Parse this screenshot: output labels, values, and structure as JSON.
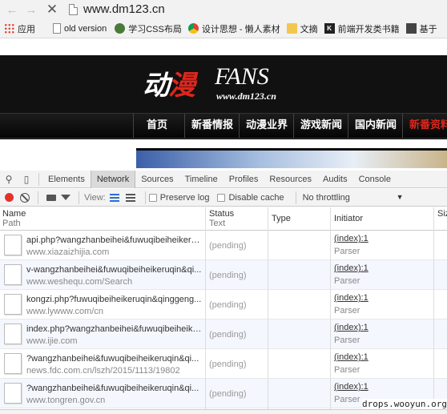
{
  "browser": {
    "url": "www.dm123.cn",
    "bookmarks": [
      {
        "label": "应用",
        "icon": "apps-grid-icon"
      },
      {
        "label": "old version",
        "icon": "page-icon"
      },
      {
        "label": "学习CSS布局",
        "icon": "css-icon"
      },
      {
        "label": "设计思想 - 懒人素材",
        "icon": "chrome-icon"
      },
      {
        "label": "文摘",
        "icon": "folder-icon"
      },
      {
        "label": "前端开发类书籍",
        "icon": "bookmark-icon"
      },
      {
        "label": "基于",
        "icon": "bookmark-icon"
      }
    ]
  },
  "site": {
    "logo_cn_1": "动",
    "logo_cn_2": "漫",
    "logo_fans": "FANS",
    "logo_url": "www.dm123.cn",
    "nav": [
      "首页",
      "新番情报",
      "动漫业界",
      "游戏新闻",
      "国内新闻",
      "新番资料"
    ]
  },
  "devtools": {
    "tabs": [
      "Elements",
      "Network",
      "Sources",
      "Timeline",
      "Profiles",
      "Resources",
      "Audits",
      "Console"
    ],
    "active_tab": "Network",
    "toolbar": {
      "view_label": "View:",
      "preserve_log": "Preserve log",
      "disable_cache": "Disable cache",
      "throttling": "No throttling"
    },
    "columns": {
      "name": "Name",
      "path": "Path",
      "status": "Status",
      "text": "Text",
      "type": "Type",
      "initiator": "Initiator",
      "size": "Siz"
    },
    "rows": [
      {
        "name": "api.php?wangzhanbeihei&fuwuqibeiheikeru...",
        "path": "www.xiazaizhijia.com",
        "status": "(pending)",
        "initiator": "(index):1",
        "initiator_type": "Parser"
      },
      {
        "name": "v-wangzhanbeihei&fuwuqibeiheikeruqin&qi...",
        "path": "www.weshequ.com/Search",
        "status": "(pending)",
        "initiator": "(index):1",
        "initiator_type": "Parser"
      },
      {
        "name": "kongzi.php?fuwuqibeiheikeruqin&qinggeng...",
        "path": "www.lywww.com/cn",
        "status": "(pending)",
        "initiator": "(index):1",
        "initiator_type": "Parser"
      },
      {
        "name": "index.php?wangzhanbeihei&fuwuqibeiheike...",
        "path": "www.ijie.com",
        "status": "(pending)",
        "initiator": "(index):1",
        "initiator_type": "Parser"
      },
      {
        "name": "?wangzhanbeihei&fuwuqibeiheikeruqin&qi...",
        "path": "news.fdc.com.cn/lszh/2015/1113/19802",
        "status": "(pending)",
        "initiator": "(index):1",
        "initiator_type": "Parser"
      },
      {
        "name": "?wangzhanbeihei&fuwuqibeiheikeruqin&qi...",
        "path": "www.tongren.gov.cn",
        "status": "(pending)",
        "initiator": "(index):1",
        "initiator_type": "Parser"
      }
    ]
  },
  "watermark": "drops.wooyun.org"
}
